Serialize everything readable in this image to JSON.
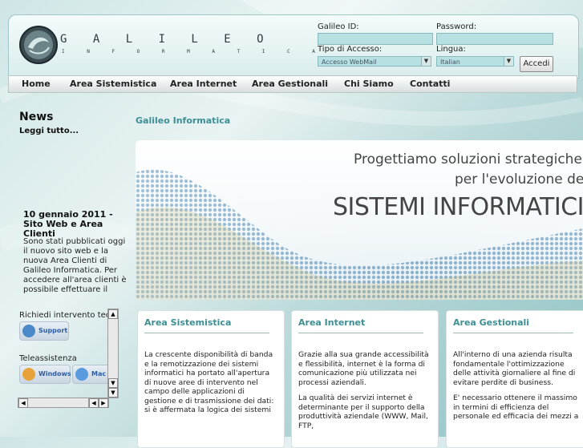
{
  "header": {
    "brand": "G A L I L E O",
    "brand_sub": "I N F O R M A T I C A",
    "login": {
      "id_label": "Galileo ID:",
      "password_label": "Password:",
      "access_type_label": "Tipo di Accesso:",
      "access_type_value": "Accesso WebMail",
      "language_label": "Lingua:",
      "language_value": "Italian",
      "submit_label": "Accedi"
    }
  },
  "nav": {
    "items": [
      "Home",
      "Area Sistemistica",
      "Area Internet",
      "Area Gestionali",
      "Chi Siamo",
      "Contatti"
    ]
  },
  "news": {
    "title": "News",
    "read_more": "Leggi tutto...",
    "item_date": "10 gennaio 2011 - Sito Web e Area Clienti",
    "item_text": "Sono stati pubblicati oggi il nuovo sito web e la nuova Area Clienti di Galileo Informatica. Per accedere all'area clienti è possibile effettuare il login dall'area"
  },
  "sidebar": {
    "intervention_label": "Richiedi intervento tecnico",
    "support_label": "Support",
    "teleassist_label": "Teleassistenza",
    "windows_label": "Windows",
    "mac_label": "Mac"
  },
  "main": {
    "title": "Galileo Informatica",
    "banner": {
      "line1": "Progettiamo soluzioni strategiche",
      "line2": "per l'evoluzione dei",
      "line3": "SISTEMI INFORMATICI"
    },
    "cards": [
      {
        "title": "Area Sistemistica",
        "paragraphs": [
          "La crescente disponibilità di banda e la remotizzazione dei sistemi informatici ha portato all'apertura di nuove aree di intervento nel campo delle applicazioni di gestione e di trasmissione dei dati: si è affermata la logica dei sistemi"
        ]
      },
      {
        "title": "Area Internet",
        "paragraphs": [
          "Grazie alla sua grande accessibilità e flessibilità, internet è la forma di comunicazione più utilizzata nei processi aziendali.",
          "La qualità dei servizi internet è determinante per il supporto della produttività aziendale (WWW, Mail, FTP,"
        ]
      },
      {
        "title": "Area Gestionali",
        "paragraphs": [
          "All'interno di una azienda risulta fondamentale l'ottimizzazione delle attività giornaliere al fine di evitare perdite di business.",
          "E' necessario ottenere il massimo in termini di efficienza del personale ed efficacia dei mezzi a"
        ]
      }
    ]
  }
}
